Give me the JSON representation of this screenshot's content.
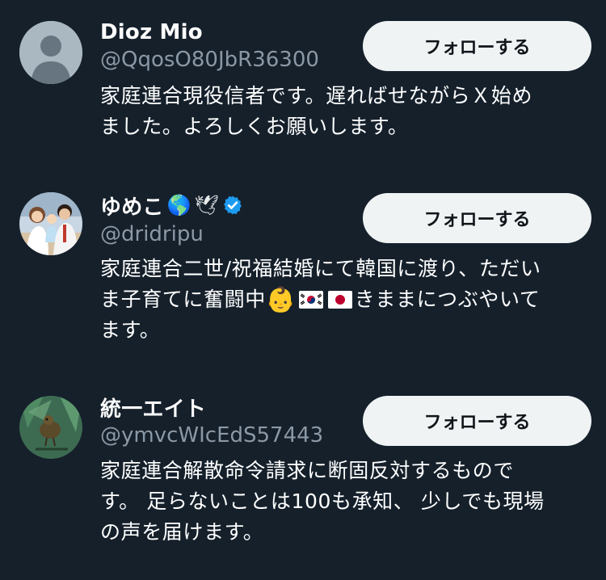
{
  "accounts": [
    {
      "name": "Dioz Mio",
      "handle": "@QqosO80JbR36300",
      "bio_line1": "家庭連合現役信者です。遅ればせながらＸ始め",
      "bio_line2": "ました。よろしくお願いします。",
      "follow_label": "フォローする",
      "avatar": "default-avatar"
    },
    {
      "name": "ゆめこ",
      "name_emojis": [
        "🌎",
        "🕊"
      ],
      "verified": true,
      "handle": "@dridripu",
      "bio_line1": "家庭連合二世/祝福結婚にて韓国に渡り、ただい",
      "bio_line2_a": "ま子育てに奮闘中",
      "bio_line2_emojis": [
        "👶",
        "🇰🇷",
        "🇯🇵"
      ],
      "bio_line2_b": "きままにつぶやいて",
      "bio_line3": "ます。",
      "follow_label": "フォローする",
      "avatar": "family-photo"
    },
    {
      "name": "統一エイト",
      "handle": "@ymvcWIcEdS57443",
      "bio_line1": "家庭連合解散命令請求に断固反対するもので",
      "bio_line2": "す。 足らないことは100も承知、 少しでも現場",
      "bio_line3": "の声を届けます。",
      "follow_label": "フォローする",
      "avatar": "bird-photo"
    }
  ],
  "colors": {
    "background": "#15202b",
    "text": "#ffffff",
    "secondary_text": "#8b98a5",
    "button_bg": "#eff3f4",
    "button_text": "#0f1419",
    "verified": "#1d9bf0"
  }
}
